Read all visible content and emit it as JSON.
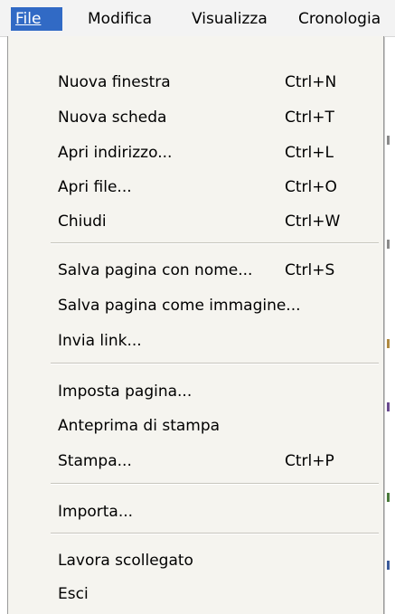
{
  "menubar": {
    "file": "File",
    "modifica": "Modifica",
    "visualizza": "Visualizza",
    "cronologia": "Cronologia"
  },
  "file_menu": {
    "nuova_finestra": {
      "label": "Nuova finestra",
      "shortcut": "Ctrl+N"
    },
    "nuova_scheda": {
      "label": "Nuova scheda",
      "shortcut": "Ctrl+T"
    },
    "apri_indirizzo": {
      "label": "Apri indirizzo...",
      "shortcut": "Ctrl+L"
    },
    "apri_file": {
      "label": "Apri file...",
      "shortcut": "Ctrl+O"
    },
    "chiudi": {
      "label": "Chiudi",
      "shortcut": "Ctrl+W"
    },
    "salva_pagina": {
      "label": "Salva pagina con nome...",
      "shortcut": "Ctrl+S"
    },
    "salva_immagine": {
      "label": "Salva pagina come immagine..."
    },
    "invia_link": {
      "label": "Invia link..."
    },
    "imposta_pagina": {
      "label": "Imposta pagina..."
    },
    "anteprima": {
      "label": "Anteprima di stampa"
    },
    "stampa": {
      "label": "Stampa...",
      "shortcut": "Ctrl+P"
    },
    "importa": {
      "label": "Importa..."
    },
    "lavora_scollegato": {
      "label": "Lavora scollegato"
    },
    "esci": {
      "label": "Esci"
    }
  },
  "colors": {
    "highlight": "#316ac5",
    "menu_background": "#f5f4ef",
    "menubar_background": "#f3f3f3"
  }
}
